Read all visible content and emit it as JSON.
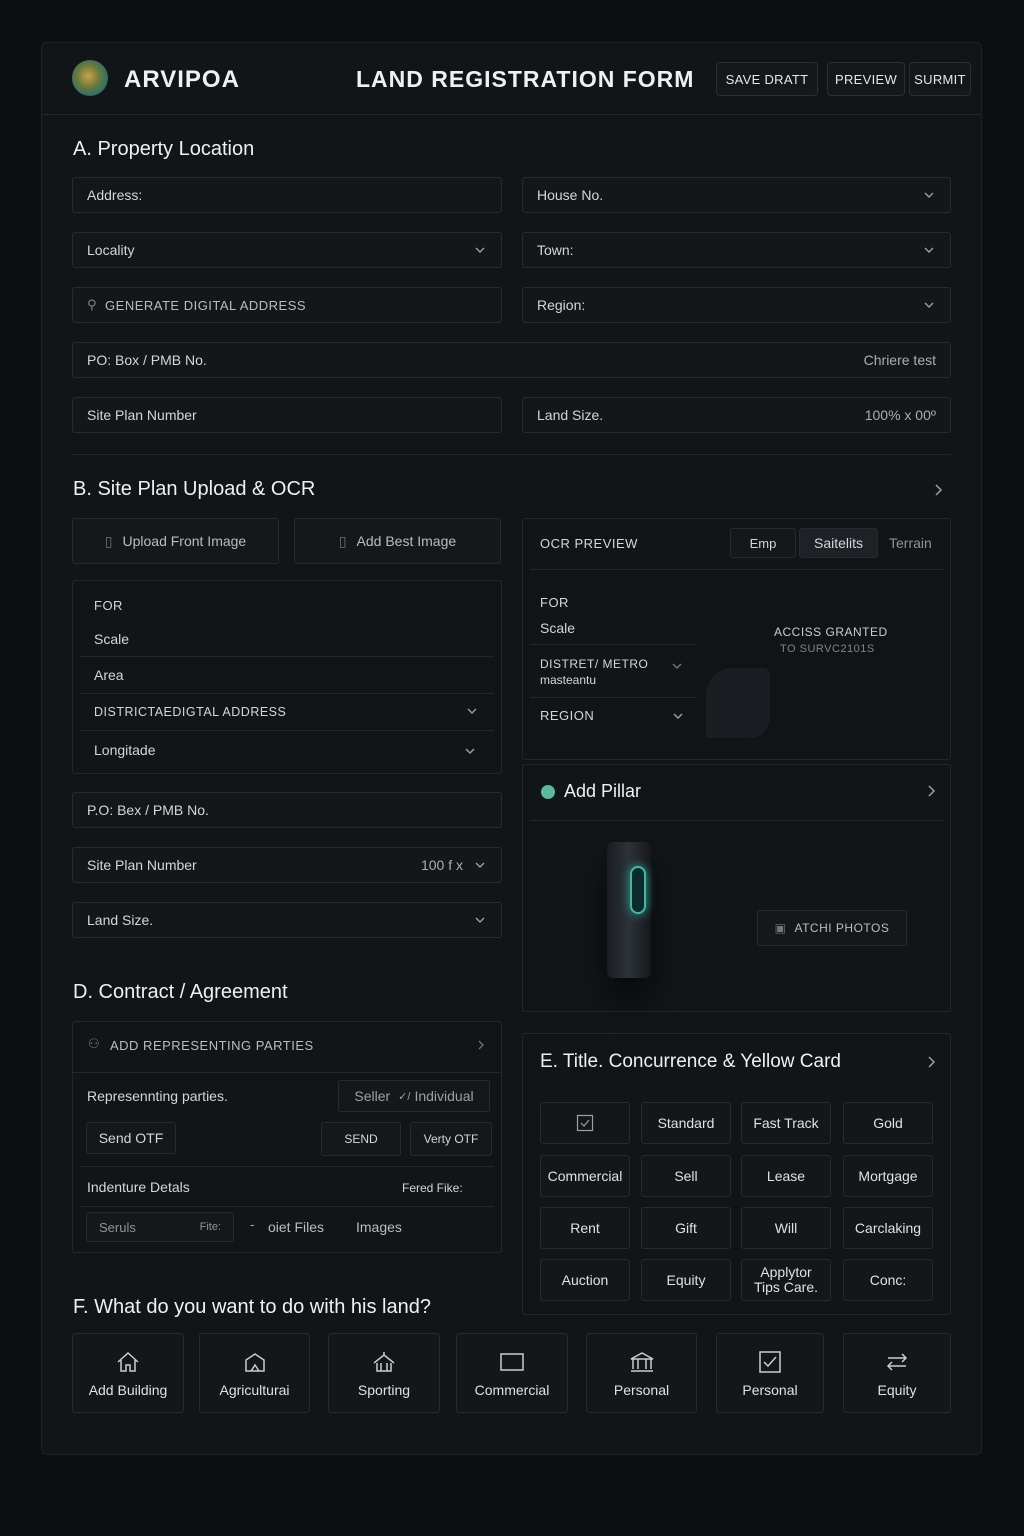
{
  "header": {
    "brand": "ARVIPOA",
    "title": "LAND REGISTRATION FORM",
    "save_draft": "SAVE DRATT",
    "preview": "PREVIEW",
    "submit": "SURMIT"
  },
  "section_a": {
    "title": "A.  Property Location",
    "address": "Address:",
    "house_no": "House No.",
    "locality": "Locality",
    "town": "Town:",
    "generate": "GENERATE DIGITAL ADDRESS",
    "region": "Region:",
    "po_box": "PO: Box / PMB No.",
    "po_box_value": "Chriere test",
    "site_plan": "Site Plan Number",
    "land_size": "Land Size.",
    "land_size_value": "100% x 00º"
  },
  "section_b": {
    "title": "B.  Site Plan Upload & OCR",
    "upload_front": "Upload Front Image",
    "add_best": "Add Best Image",
    "for": "FOR",
    "scale": "Scale",
    "area": "Area",
    "district": "DISTRICTAEDIGTAL ADDRESS",
    "longitude": "Longitade",
    "po_box": "P.O: Bex / PMB No.",
    "site_plan": "Site Plan Number",
    "site_plan_value": "100 f x",
    "land_size": "Land Size."
  },
  "ocr": {
    "title": "OCR PREVIEW",
    "tabs": [
      "Emp",
      "Saitelits",
      "Terrain"
    ],
    "for": "FOR",
    "scale": "Scale",
    "district": "DISTRET/ METRO",
    "district_sub": "masteantu",
    "region": "REGION",
    "access1": "ACCISS GRANTED",
    "access2": "TO SURVC2101S"
  },
  "pillar": {
    "title": "Add Pillar",
    "attach": "ATCHI PHOTOS"
  },
  "section_d": {
    "title": "D.  Contract / Agreement",
    "add_parties": "ADD REPRESENTING PARTIES",
    "rep_parties": "Represennting parties.",
    "seller": "Seller",
    "individual": "Individual",
    "send_otp": "Send OTF",
    "send": "SEND",
    "verify": "Verty OTF",
    "indenture": "Indenture Detals",
    "fered_files": "Fered Fike:",
    "seruls": "Seruls",
    "files": "Fite:",
    "oiet_files": "oiet Files",
    "images": "Images"
  },
  "section_e": {
    "title": "E.  Title. Concurrence & Yellow Card",
    "tiles": [
      [
        "",
        "Standard",
        "Fast Track",
        "Gold"
      ],
      [
        "Commercial",
        "Sell",
        "Lease",
        "Mortgage"
      ],
      [
        "Rent",
        "Gift",
        "Will",
        "Carclaking"
      ],
      [
        "Auction",
        "Equity",
        "Applytor Tips Care.",
        "Conc:"
      ]
    ]
  },
  "section_f": {
    "title": "F.  What do you want to do with his land?",
    "cards": [
      "Add Building",
      "Agriculturai",
      "Sporting",
      "Commercial",
      "Personal",
      "Personal",
      "Equity"
    ]
  },
  "colors": {
    "bg": "#0d0f11",
    "panel": "#121518",
    "border": "#262b30",
    "accent_green": "#4fd1a8"
  }
}
